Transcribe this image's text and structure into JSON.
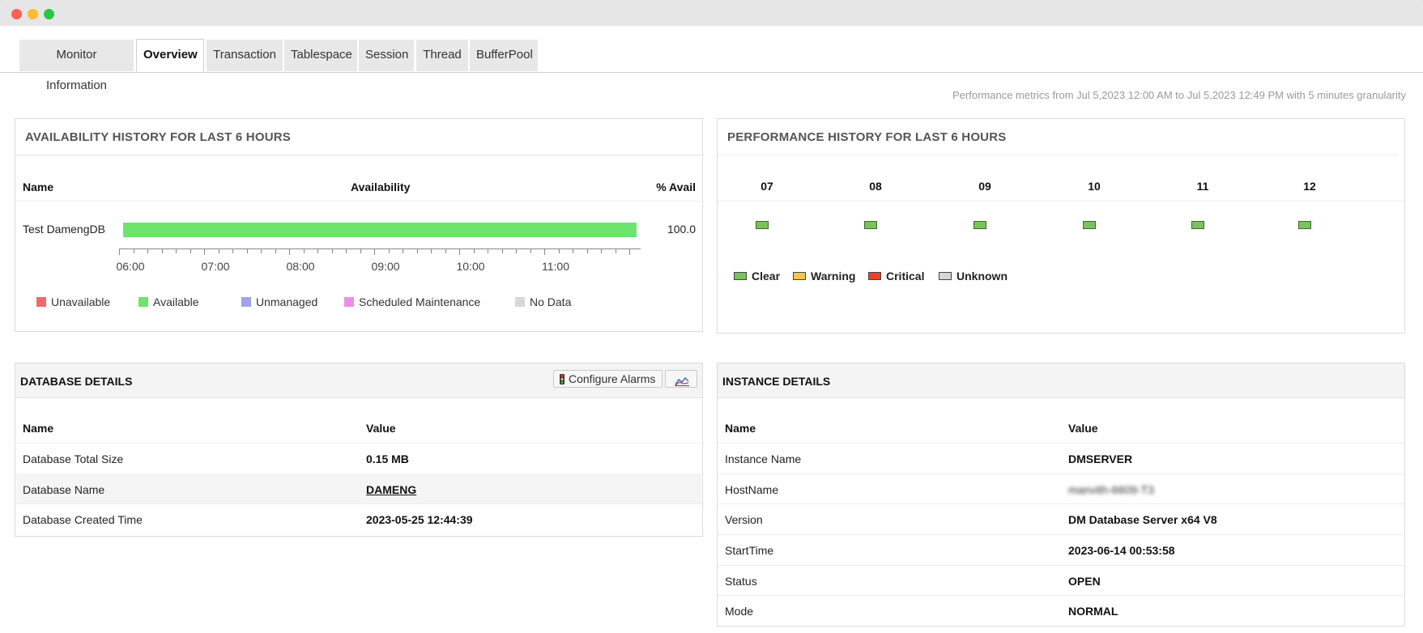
{
  "tabs": [
    {
      "label": "Monitor Information",
      "active": false
    },
    {
      "label": "Overview",
      "active": true
    },
    {
      "label": "Transaction",
      "active": false
    },
    {
      "label": "Tablespace",
      "active": false
    },
    {
      "label": "Session",
      "active": false
    },
    {
      "label": "Thread",
      "active": false
    },
    {
      "label": "BufferPool",
      "active": false
    }
  ],
  "performance_note": "Performance metrics from Jul 5,2023 12:00 AM to Jul 5,2023 12:49 PM with 5 minutes granularity",
  "availability": {
    "title": "AVAILABILITY HISTORY FOR LAST 6 HOURS",
    "headers": {
      "name": "Name",
      "availability": "Availability",
      "percent": "% Avail"
    },
    "row": {
      "name": "Test DamengDB",
      "percent": "100.0",
      "available_fraction": 1.0,
      "color": "#6ee36e"
    },
    "axis_labels": [
      "06:00",
      "07:00",
      "08:00",
      "09:00",
      "10:00",
      "11:00"
    ],
    "legend": [
      {
        "label": "Unavailable",
        "color": "#ef6b6b"
      },
      {
        "label": "Available",
        "color": "#6ee36e"
      },
      {
        "label": "Unmanaged",
        "color": "#a3a3e6"
      },
      {
        "label": "Scheduled Maintenance",
        "color": "#ee8ee6"
      },
      {
        "label": "No Data",
        "color": "#d8d8d8"
      }
    ]
  },
  "performance": {
    "title": "PERFORMANCE HISTORY FOR LAST 6 HOURS",
    "hours": [
      "07",
      "08",
      "09",
      "10",
      "11",
      "12"
    ],
    "hour_status": [
      "Clear",
      "Clear",
      "Clear",
      "Clear",
      "Clear",
      "Clear"
    ],
    "legend": [
      {
        "label": "Clear",
        "color": "#7ac35a"
      },
      {
        "label": "Warning",
        "color": "#f3c849"
      },
      {
        "label": "Critical",
        "color": "#e8422a"
      },
      {
        "label": "Unknown",
        "color": "#d6d6d6"
      }
    ]
  },
  "database_details": {
    "title": "DATABASE DETAILS",
    "configure_alarms_label": "Configure Alarms",
    "headers": {
      "name": "Name",
      "value": "Value"
    },
    "rows": [
      {
        "name": "Database Total Size",
        "value": "0.15 MB"
      },
      {
        "name": "Database Name",
        "value": "DAMENG"
      },
      {
        "name": "Database Created Time",
        "value": "2023-05-25 12:44:39"
      }
    ]
  },
  "instance_details": {
    "title": "INSTANCE DETAILS",
    "headers": {
      "name": "Name",
      "value": "Value"
    },
    "rows": [
      {
        "name": "Instance Name",
        "value": "DMSERVER"
      },
      {
        "name": "HostName",
        "value": "manvith-6609-T3"
      },
      {
        "name": "Version",
        "value": "DM Database Server x64 V8"
      },
      {
        "name": "StartTime",
        "value": "2023-06-14 00:53:58"
      },
      {
        "name": "Status",
        "value": "OPEN"
      },
      {
        "name": "Mode",
        "value": "NORMAL"
      }
    ]
  }
}
